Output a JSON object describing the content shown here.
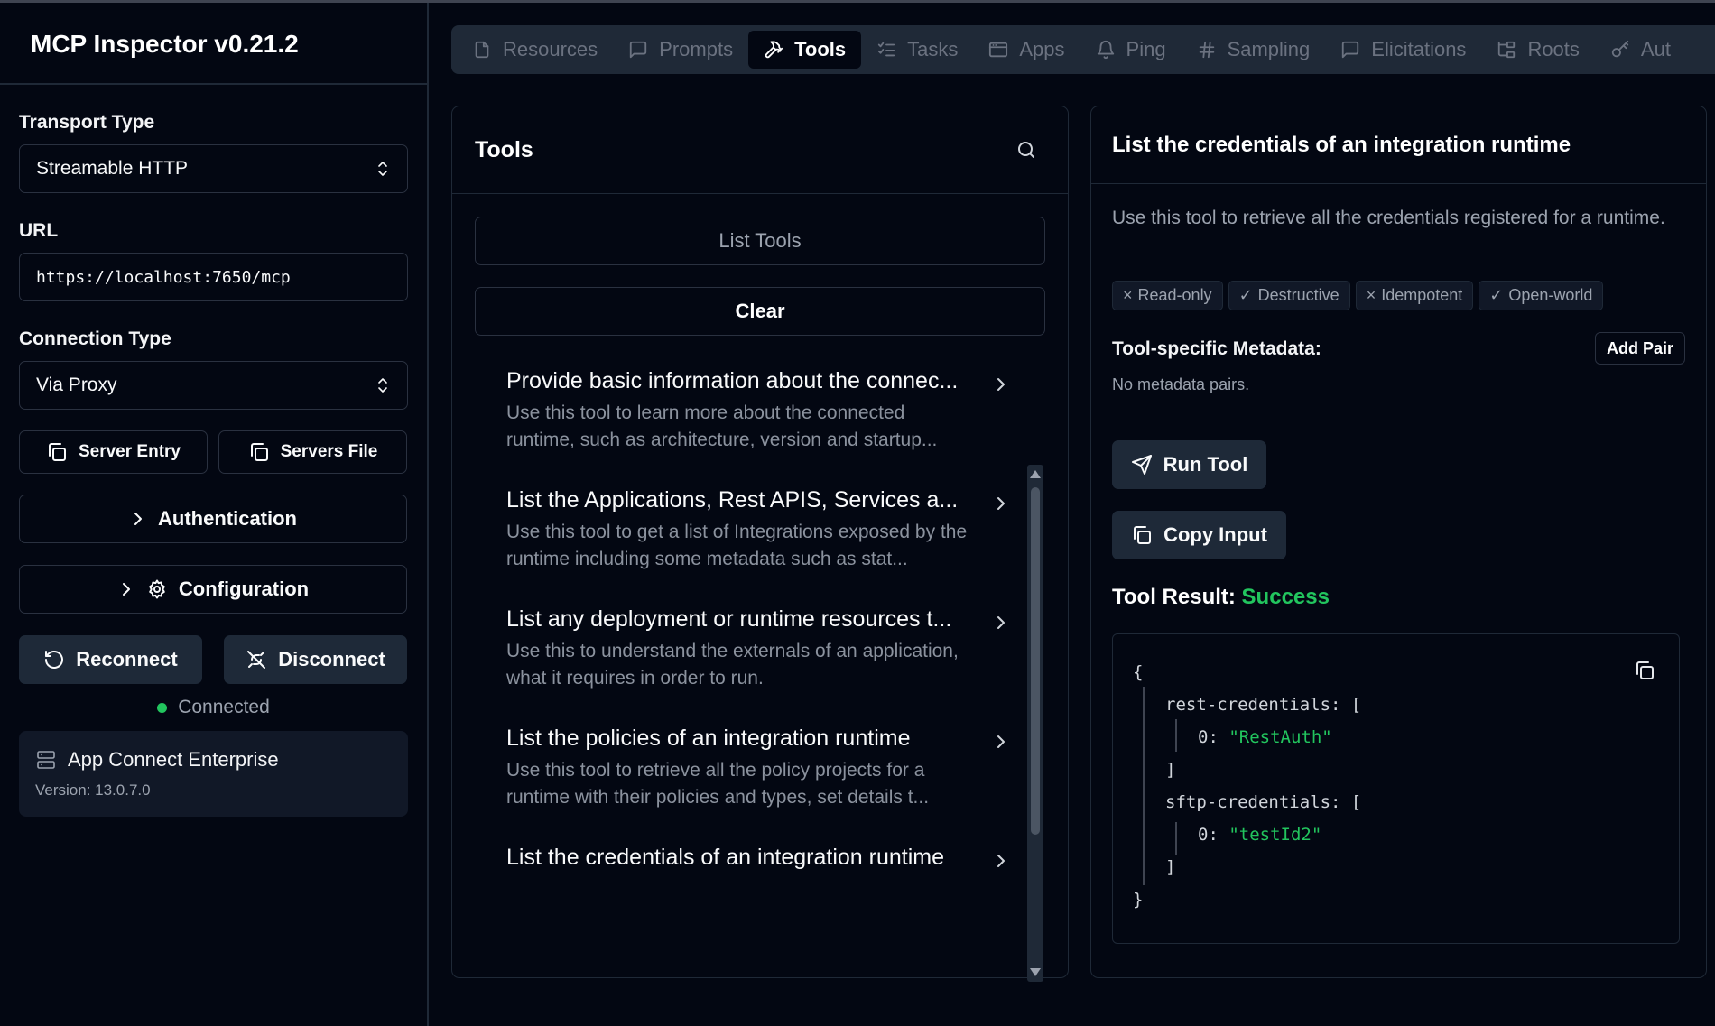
{
  "app": {
    "title": "MCP Inspector v0.21.2"
  },
  "sidebar": {
    "transport_label": "Transport Type",
    "transport_value": "Streamable HTTP",
    "url_label": "URL",
    "url_value": "https://localhost:7650/mcp",
    "connection_label": "Connection Type",
    "connection_value": "Via Proxy",
    "server_entry": "Server Entry",
    "servers_file": "Servers File",
    "authentication": "Authentication",
    "configuration": "Configuration",
    "reconnect": "Reconnect",
    "disconnect": "Disconnect",
    "status": "Connected",
    "server_name": "App Connect Enterprise",
    "server_version": "Version: 13.0.7.0"
  },
  "tabs": [
    {
      "label": "Resources",
      "icon": "file-icon"
    },
    {
      "label": "Prompts",
      "icon": "message-icon"
    },
    {
      "label": "Tools",
      "icon": "hammer-icon",
      "active": true
    },
    {
      "label": "Tasks",
      "icon": "list-checks-icon"
    },
    {
      "label": "Apps",
      "icon": "app-window-icon"
    },
    {
      "label": "Ping",
      "icon": "bell-icon"
    },
    {
      "label": "Sampling",
      "icon": "hash-icon"
    },
    {
      "label": "Elicitations",
      "icon": "message-icon"
    },
    {
      "label": "Roots",
      "icon": "folder-tree-icon"
    },
    {
      "label": "Aut",
      "icon": "key-icon"
    }
  ],
  "tools_panel": {
    "title": "Tools",
    "list_button": "List Tools",
    "clear_button": "Clear",
    "items": [
      {
        "name": "Provide basic information about the connec...",
        "desc": "Use this tool to learn more about the connected runtime, such as architecture, version and startup..."
      },
      {
        "name": "List the Applications, Rest APIS, Services a...",
        "desc": "Use this tool to get a list of Integrations exposed by the runtime including some metadata such as stat..."
      },
      {
        "name": "List any deployment or runtime resources t...",
        "desc": "Use this to understand the externals of an application, what it requires in order to run."
      },
      {
        "name": "List the policies of an integration runtime",
        "desc": "Use this tool to retrieve all the policy projects for a runtime with their policies and types, set details t..."
      },
      {
        "name": "List the credentials of an integration runtime",
        "desc": ""
      }
    ]
  },
  "detail": {
    "title": "List the credentials of an integration runtime",
    "description": "Use this tool to retrieve all the credentials registered for a runtime.",
    "badges": [
      {
        "label": "Read-only",
        "mark": "×"
      },
      {
        "label": "Destructive",
        "mark": "✓"
      },
      {
        "label": "Idempotent",
        "mark": "×"
      },
      {
        "label": "Open-world",
        "mark": "✓"
      }
    ],
    "metadata_label": "Tool-specific Metadata:",
    "add_pair": "Add Pair",
    "no_metadata": "No metadata pairs.",
    "run_tool": "Run Tool",
    "copy_input": "Copy Input",
    "result_label": "Tool Result:",
    "result_status": "Success",
    "result": {
      "open": "{",
      "k1": "rest-credentials:",
      "b1": "[",
      "i1": "0:",
      "v1": "\"RestAuth\"",
      "e1": "]",
      "k2": "sftp-credentials:",
      "b2": "[",
      "i2": "0:",
      "v2": "\"testId2\"",
      "e2": "]",
      "close": "}"
    }
  }
}
